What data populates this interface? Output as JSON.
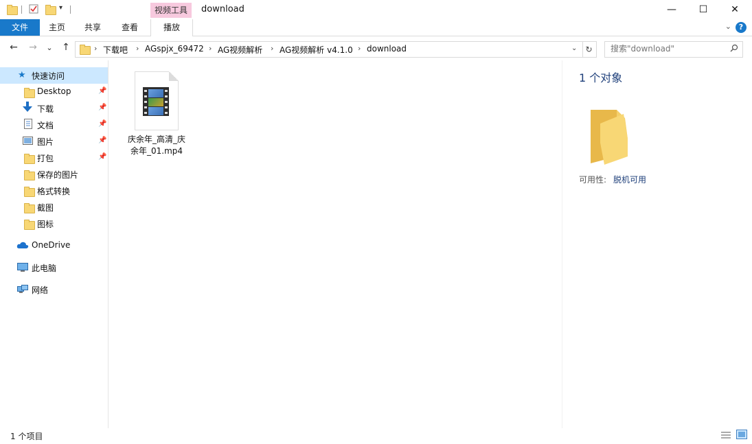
{
  "window": {
    "title": "download",
    "context_tab": "视频工具",
    "controls": {
      "minimize": "—",
      "maximize": "☐",
      "close": "✕"
    }
  },
  "ribbon": {
    "tabs": [
      "文件",
      "主页",
      "共享",
      "查看",
      "播放"
    ],
    "help": "?",
    "expand": "⌄"
  },
  "nav": {
    "back": "←",
    "forward": "→",
    "recent": "⌄",
    "up": "↑",
    "breadcrumb": [
      "下载吧",
      "AGspjx_69472",
      "AG视频解析",
      "AG视频解析 v4.1.0",
      "download"
    ],
    "refresh": "↻"
  },
  "search": {
    "placeholder": "搜索\"download\""
  },
  "sidebar": {
    "items": [
      {
        "label": "快速访问",
        "icon": "star-icon"
      },
      {
        "label": "Desktop",
        "icon": "folder-icon",
        "pinned": true
      },
      {
        "label": "下载",
        "icon": "download-arrow-icon",
        "pinned": true
      },
      {
        "label": "文档",
        "icon": "document-icon",
        "pinned": true
      },
      {
        "label": "图片",
        "icon": "pictures-icon",
        "pinned": true
      },
      {
        "label": "打包",
        "icon": "folder-icon",
        "pinned": true
      },
      {
        "label": "保存的图片",
        "icon": "folder-icon"
      },
      {
        "label": "格式转换",
        "icon": "folder-icon"
      },
      {
        "label": "截图",
        "icon": "folder-icon"
      },
      {
        "label": "图标",
        "icon": "folder-icon"
      },
      {
        "label": "OneDrive",
        "icon": "cloud-icon"
      },
      {
        "label": "此电脑",
        "icon": "computer-icon"
      },
      {
        "label": "网络",
        "icon": "network-icon"
      }
    ]
  },
  "files": [
    {
      "name_line1": "庆余年_高清_庆",
      "name_line2": "余年_01.mp4",
      "icon": "video-file-icon"
    }
  ],
  "details": {
    "count": "1 个对象",
    "availability_label": "可用性:",
    "availability_value": "脱机可用"
  },
  "status": {
    "text": "1 个项目"
  }
}
